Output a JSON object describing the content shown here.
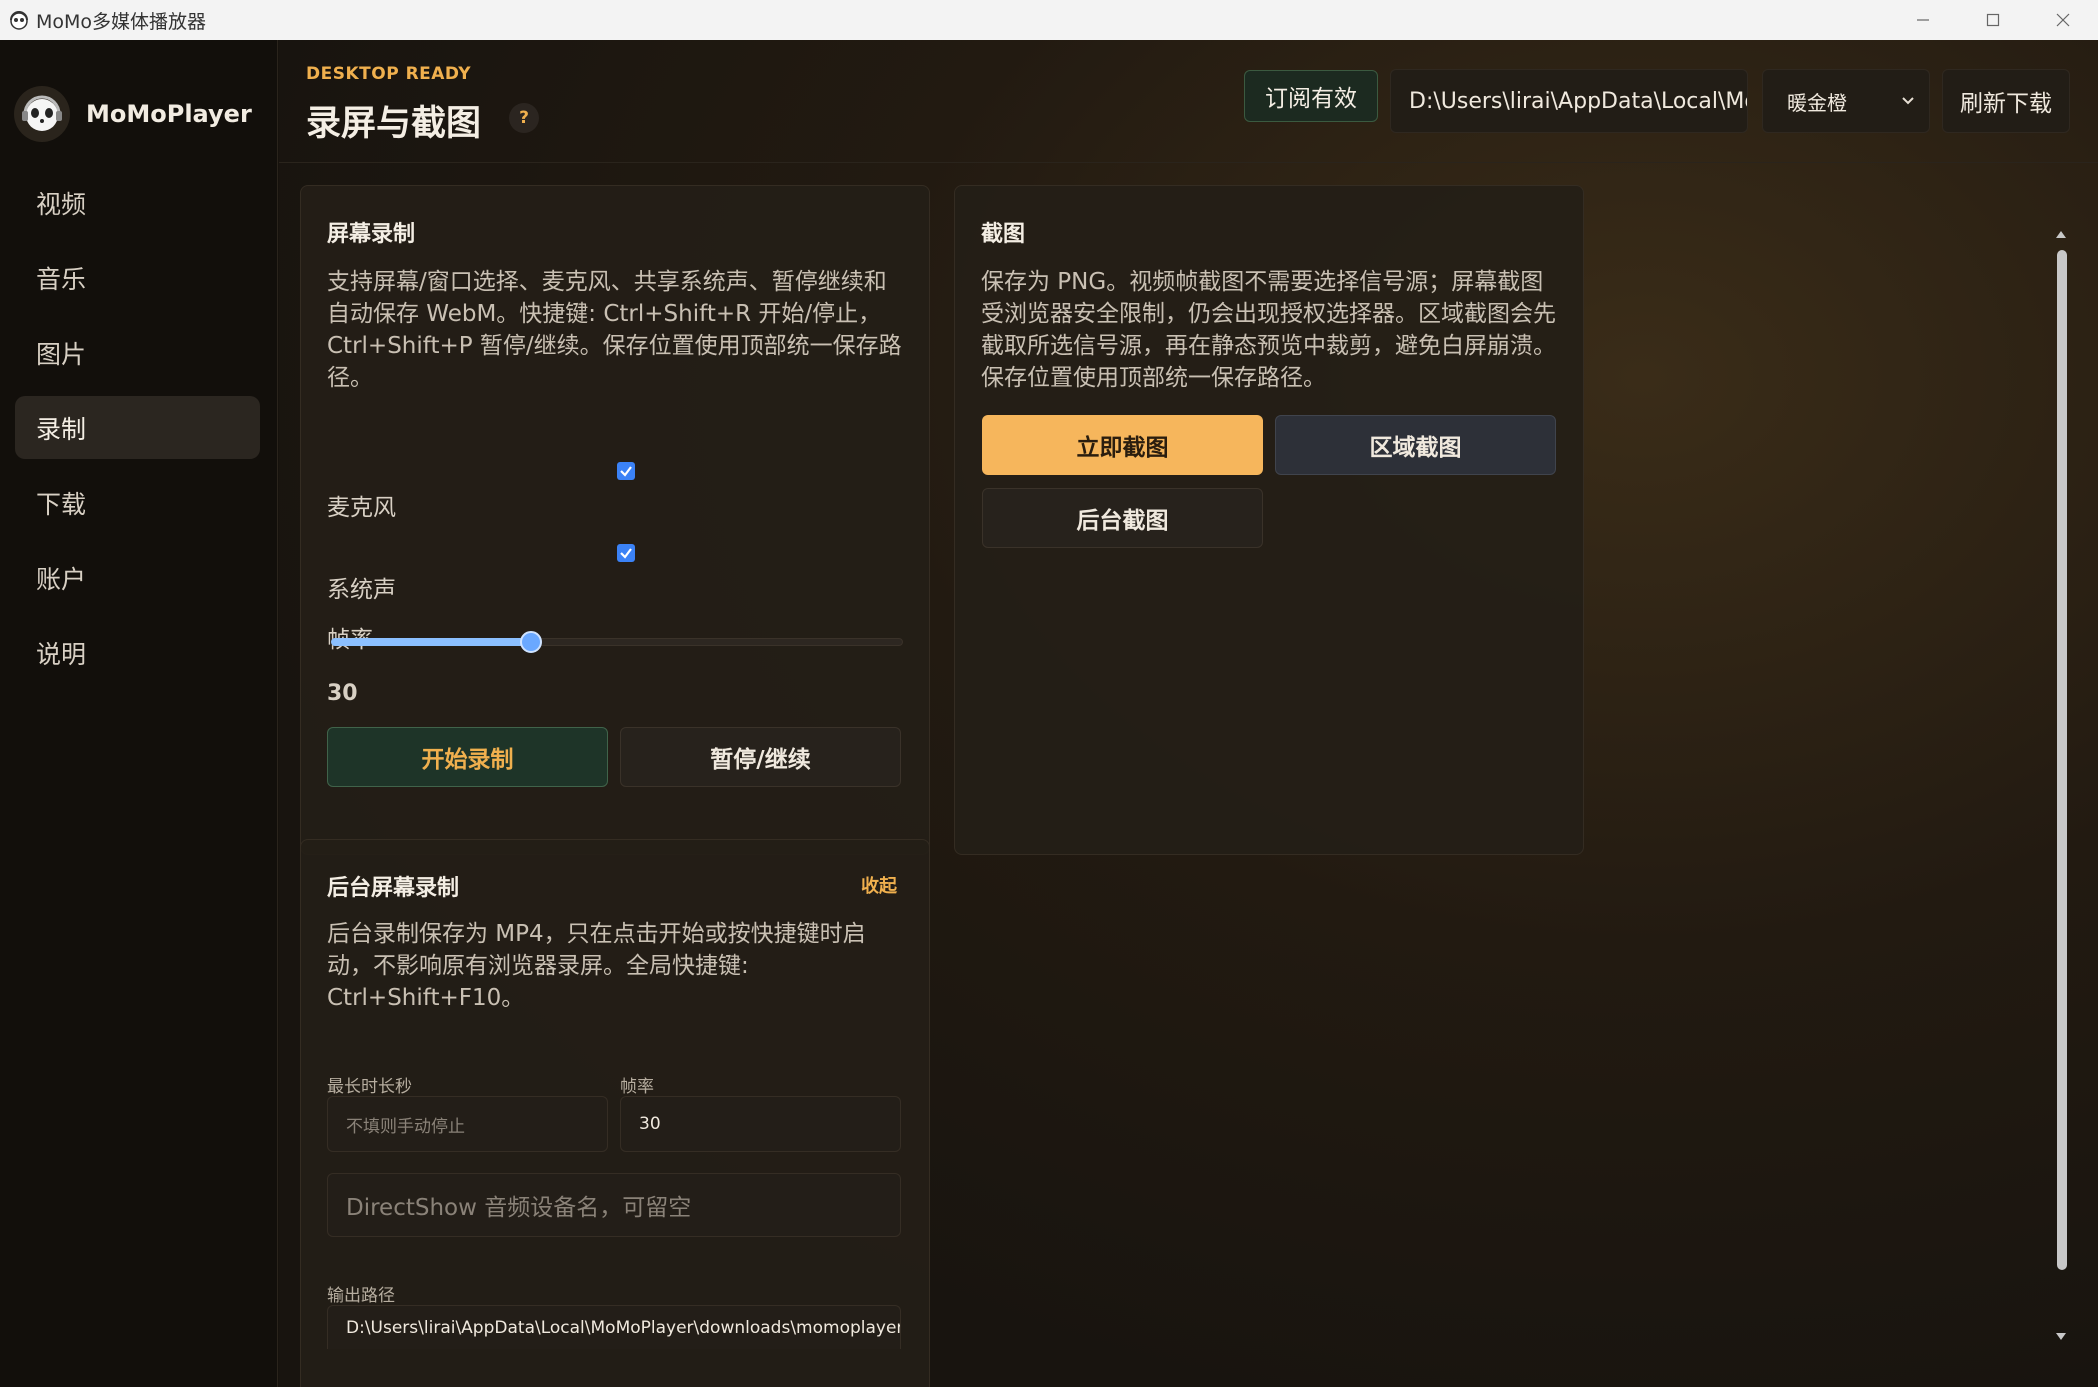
{
  "window": {
    "title": "MoMo多媒体播放器",
    "icon": "panda-headphone-icon",
    "controls": [
      "minimize-icon",
      "maximize-icon",
      "close-icon"
    ]
  },
  "sidebar": {
    "brand": "MoMoPlayer",
    "items": [
      {
        "label": "视频",
        "active": false
      },
      {
        "label": "音乐",
        "active": false
      },
      {
        "label": "图片",
        "active": false
      },
      {
        "label": "录制",
        "active": true
      },
      {
        "label": "下载",
        "active": false
      },
      {
        "label": "账户",
        "active": false
      },
      {
        "label": "说明",
        "active": false
      }
    ]
  },
  "header": {
    "eyebrow": "DESKTOP READY",
    "title": "录屏与截图",
    "help": "?",
    "subscription": "订阅有效",
    "save_path": "D:\\Users\\lirai\\AppData\\Local\\MoMoPlayer\\downloads\\momoplayer",
    "theme": {
      "selected": "暖金橙"
    },
    "refresh": "刷新下载"
  },
  "screen_record": {
    "title": "屏幕录制",
    "desc": "支持屏幕/窗口选择、麦克风、共享系统声、暂停继续和自动保存 WebM。快捷键: Ctrl+Shift+R 开始/停止，Ctrl+Shift+P 暂停/继续。保存位置使用顶部统一保存路径。",
    "mic_label": "麦克风",
    "mic_checked": true,
    "sys_label": "系统声",
    "sys_checked": true,
    "fps_label": "帧率",
    "fps_value": "30",
    "fps_fraction": 0.35,
    "start": "开始录制",
    "pause": "暂停/继续"
  },
  "screenshot": {
    "title": "截图",
    "desc": "保存为 PNG。视频帧截图不需要选择信号源；屏幕截图受浏览器安全限制，仍会出现授权选择器。区域截图会先截取所选信号源，再在静态预览中裁剪，避免白屏崩溃。保存位置使用顶部统一保存路径。",
    "capture_now": "立即截图",
    "region": "区域截图",
    "background": "后台截图"
  },
  "bg_record": {
    "title": "后台屏幕录制",
    "collapse": "收起",
    "desc": "后台录制保存为 MP4，只在点击开始或按快捷键时启动，不影响原有浏览器录屏。全局快捷键: Ctrl+Shift+F10。",
    "max_duration_label": "最长时长秒",
    "max_duration_placeholder": "不填则手动停止",
    "fps_label": "帧率",
    "fps_value": "30",
    "audio_placeholder": "DirectShow 音频设备名，可留空",
    "output_label": "输出路径",
    "output_value": "D:\\Users\\lirai\\AppData\\Local\\MoMoPlayer\\downloads\\momoplayer"
  },
  "colors": {
    "accent": "#f0b04e",
    "primary_button": "#f6b65c",
    "checkbox": "#3b82f6",
    "slider": "#6aa8ff"
  }
}
